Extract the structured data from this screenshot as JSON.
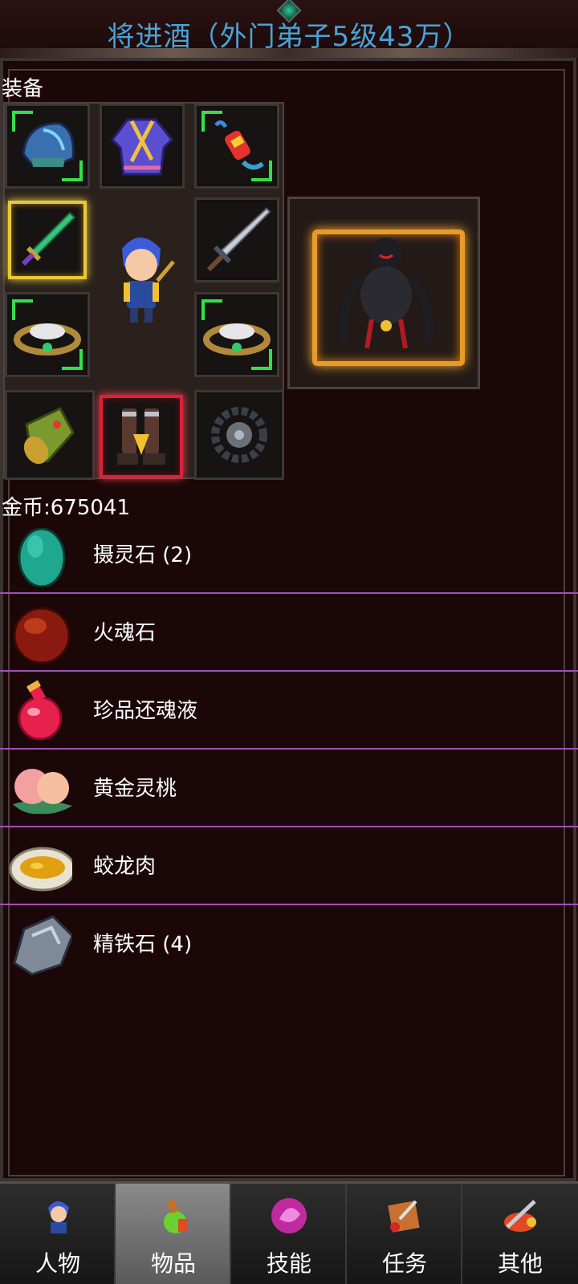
{
  "header": {
    "title": "将进酒（外门弟子5级43万）"
  },
  "equipment": {
    "section_label": "装备",
    "slots": [
      {
        "name": "helmet-icon"
      },
      {
        "name": "robe-icon"
      },
      {
        "name": "firework-amulet-icon"
      },
      {
        "name": "jade-sword-icon"
      },
      {
        "name": "steel-sword-icon"
      },
      {
        "name": "ring-left-icon"
      },
      {
        "name": "ring-right-icon"
      },
      {
        "name": "bracer-icon"
      },
      {
        "name": "boots-icon"
      },
      {
        "name": "bead-necklace-icon"
      }
    ],
    "character_icon": "hero-avatar-icon",
    "mount_icon": "shadow-demon-icon"
  },
  "inventory": {
    "gold_label": "金币:675041",
    "items": [
      {
        "label": "摄灵石 (2)",
        "icon": "spirit-stone-icon",
        "color": "#1fa88f"
      },
      {
        "label": "火魂石",
        "icon": "fire-soul-stone-icon",
        "color": "#8a1a10"
      },
      {
        "label": "珍品还魂液",
        "icon": "revival-potion-icon",
        "color": "#e8204c"
      },
      {
        "label": "黄金灵桃",
        "icon": "golden-peach-icon",
        "color": "#f3a0a0"
      },
      {
        "label": "蛟龙肉",
        "icon": "dragon-meat-icon",
        "color": "#e0a010"
      },
      {
        "label": "精铁石 (4)",
        "icon": "iron-ore-icon",
        "color": "#7f8a99"
      }
    ]
  },
  "tabs": [
    {
      "label": "人物",
      "icon": "character-tab-icon",
      "active": false
    },
    {
      "label": "物品",
      "icon": "items-tab-icon",
      "active": true
    },
    {
      "label": "技能",
      "icon": "skills-tab-icon",
      "active": false
    },
    {
      "label": "任务",
      "icon": "quests-tab-icon",
      "active": false
    },
    {
      "label": "其他",
      "icon": "other-tab-icon",
      "active": false
    }
  ],
  "colors": {
    "title_blue": "#4aa3d6",
    "divider_purple": "#a050b8",
    "background": "#1b0708"
  }
}
